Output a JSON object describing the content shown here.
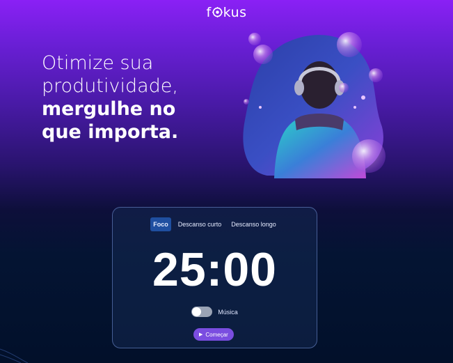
{
  "brand": {
    "prefix": "f",
    "suffix": "kus"
  },
  "headline": {
    "line1": "Otimize sua",
    "line2": "produtividade,",
    "line3": "mergulhe no",
    "line4": "que importa."
  },
  "tabs": [
    {
      "label": "Foco",
      "active": true
    },
    {
      "label": "Descanso curto",
      "active": false
    },
    {
      "label": "Descanso longo",
      "active": false
    }
  ],
  "timer": {
    "display": "25:00"
  },
  "music": {
    "label": "Música",
    "enabled": false
  },
  "start_button": {
    "label": "Começar",
    "icon": "play-icon"
  },
  "colors": {
    "accent": "#7a4de0",
    "active_tab": "#1f4fa0",
    "card_border": "#7896dc"
  }
}
